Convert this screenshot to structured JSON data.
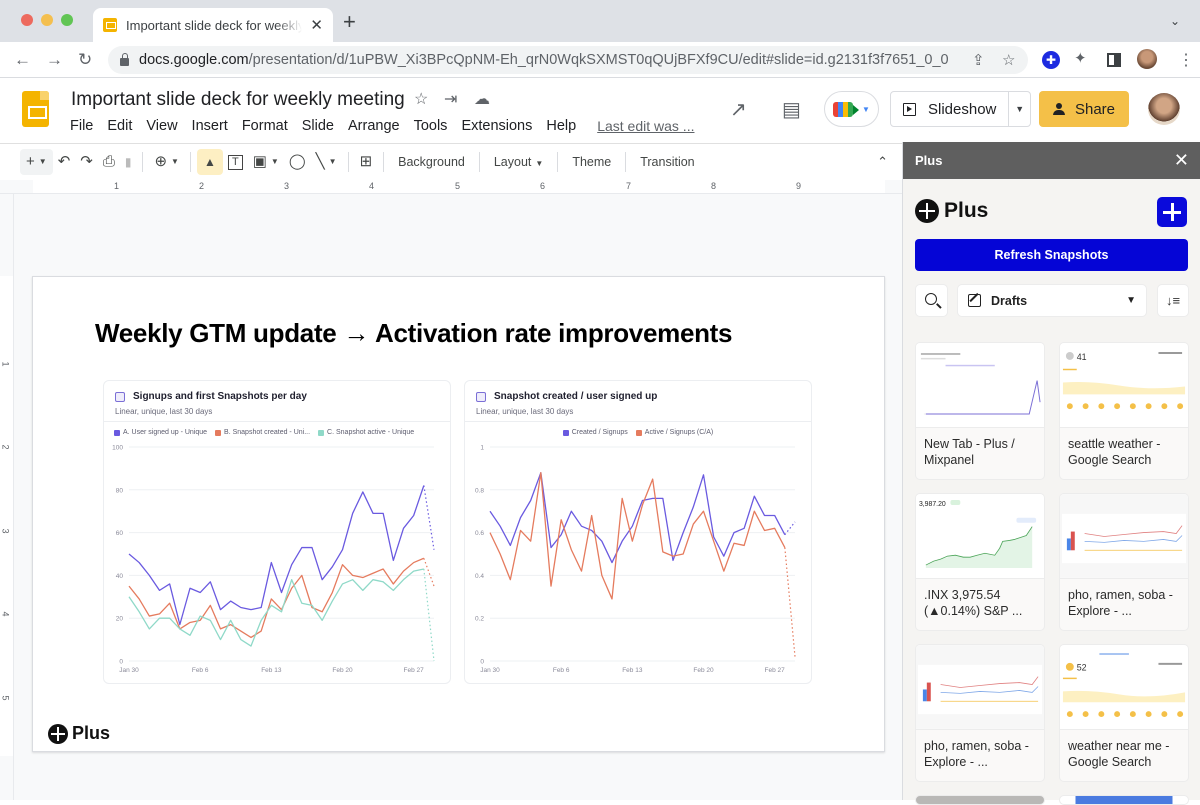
{
  "browser": {
    "tab_title": "Important slide deck for weekly meeting",
    "url_domain": "docs.google.com",
    "url_path": "/presentation/d/1uPBW_Xi3BPcQpNM-Eh_qrN0WqkSXMST0qQUjBFXf9CU/edit#slide=id.g2131f3f7651_0_0",
    "icons": {
      "back": "←",
      "forward": "→",
      "reload": "↻",
      "share": "⇪",
      "bookmark": "☆",
      "puzzle": "✦",
      "menu": "⋮",
      "new_tab": "+",
      "tab_close": "✕",
      "tab_list": "⌄"
    }
  },
  "app": {
    "doc_title": "Important slide deck for weekly meeting",
    "title_icons": {
      "star": "☆",
      "move": "⇥",
      "cloud": "☁"
    },
    "menu": [
      "File",
      "Edit",
      "View",
      "Insert",
      "Format",
      "Slide",
      "Arrange",
      "Tools",
      "Extensions",
      "Help"
    ],
    "last_edit": "Last edit was ...",
    "header_icons": {
      "activity": "↗",
      "comments": "▤"
    },
    "slideshow_label": "Slideshow",
    "share_label": "Share"
  },
  "toolbar": {
    "icons": {
      "add": "+",
      "undo": "↶",
      "redo": "↷",
      "print": "⎙",
      "paint_format": "🖌",
      "zoom": "⊕",
      "select": "➤",
      "textbox": "T",
      "image": "▣",
      "shape": "◯",
      "line": "╲",
      "comment": "⊞",
      "collapse": "⌃"
    },
    "background_label": "Background",
    "layout_label": "Layout",
    "theme_label": "Theme",
    "transition_label": "Transition"
  },
  "rulers": {
    "horizontal": [
      "1",
      "2",
      "3",
      "4",
      "5",
      "6",
      "7",
      "8",
      "9"
    ],
    "vertical": [
      "1",
      "2",
      "3",
      "4",
      "5"
    ]
  },
  "slide": {
    "title": "Weekly GTM update → Activation rate improvements",
    "logo_text": "Plus"
  },
  "chart_data": [
    {
      "type": "line",
      "title": "Signups and first Snapshots per day",
      "subtitle": "Linear, unique, last 30 days",
      "x": [
        "Jan 30",
        "Jan 31",
        "Feb 1",
        "Feb 2",
        "Feb 3",
        "Feb 4",
        "Feb 5",
        "Feb 6",
        "Feb 7",
        "Feb 8",
        "Feb 9",
        "Feb 10",
        "Feb 11",
        "Feb 12",
        "Feb 13",
        "Feb 14",
        "Feb 15",
        "Feb 16",
        "Feb 17",
        "Feb 18",
        "Feb 19",
        "Feb 20",
        "Feb 21",
        "Feb 22",
        "Feb 23",
        "Feb 24",
        "Feb 25",
        "Feb 26",
        "Feb 27",
        "Feb 28",
        "Mar 1"
      ],
      "xticks": [
        "Jan 30",
        "Feb 6",
        "Feb 13",
        "Feb 20",
        "Feb 27"
      ],
      "yticks": [
        0,
        20,
        40,
        60,
        80,
        100
      ],
      "ylim": [
        0,
        100
      ],
      "grid": true,
      "legend": "top",
      "partial_last_point": true,
      "series": [
        {
          "name": "A. User signed up - Unique",
          "color": "#6a5ae0",
          "values": [
            50,
            46,
            40,
            33,
            36,
            17,
            34,
            32,
            37,
            24,
            28,
            25,
            24,
            25,
            46,
            32,
            45,
            53,
            53,
            38,
            44,
            52,
            69,
            79,
            69,
            69,
            47,
            62,
            68,
            82,
            52
          ]
        },
        {
          "name": "B. Snapshot created - Uni...",
          "color": "#e57b5e",
          "values": [
            35,
            29,
            21,
            22,
            27,
            15,
            18,
            19,
            26,
            15,
            17,
            14,
            11,
            14,
            29,
            24,
            34,
            40,
            25,
            23,
            32,
            45,
            40,
            39,
            41,
            43,
            36,
            42,
            46,
            48,
            35
          ]
        },
        {
          "name": "C. Snapshot active - Unique",
          "color": "#8fd9c8",
          "values": [
            30,
            23,
            15,
            20,
            20,
            15,
            12,
            21,
            19,
            10,
            19,
            10,
            7,
            19,
            26,
            23,
            38,
            27,
            26,
            19,
            28,
            36,
            38,
            33,
            38,
            37,
            33,
            38,
            42,
            43,
            0
          ]
        }
      ]
    },
    {
      "type": "line",
      "title": "Snapshot created / user signed up",
      "subtitle": "Linear, unique, last 30 days",
      "x": [
        "Jan 30",
        "Jan 31",
        "Feb 1",
        "Feb 2",
        "Feb 3",
        "Feb 4",
        "Feb 5",
        "Feb 6",
        "Feb 7",
        "Feb 8",
        "Feb 9",
        "Feb 10",
        "Feb 11",
        "Feb 12",
        "Feb 13",
        "Feb 14",
        "Feb 15",
        "Feb 16",
        "Feb 17",
        "Feb 18",
        "Feb 19",
        "Feb 20",
        "Feb 21",
        "Feb 22",
        "Feb 23",
        "Feb 24",
        "Feb 25",
        "Feb 26",
        "Feb 27",
        "Feb 28",
        "Mar 1"
      ],
      "xticks": [
        "Jan 30",
        "Feb 6",
        "Feb 13",
        "Feb 20",
        "Feb 27"
      ],
      "yticks": [
        0,
        0.2,
        0.4,
        0.6,
        0.8,
        1
      ],
      "ylim": [
        0,
        1
      ],
      "grid": true,
      "legend": "top-center",
      "partial_last_point": true,
      "series": [
        {
          "name": "Created / Signups",
          "color": "#6a5ae0",
          "values": [
            0.7,
            0.63,
            0.54,
            0.67,
            0.75,
            0.88,
            0.53,
            0.59,
            0.7,
            0.63,
            0.61,
            0.56,
            0.46,
            0.56,
            0.63,
            0.75,
            0.76,
            0.76,
            0.47,
            0.6,
            0.72,
            0.87,
            0.58,
            0.49,
            0.6,
            0.62,
            0.77,
            0.68,
            0.68,
            0.59,
            0.65
          ]
        },
        {
          "name": "Active / Signups (C/A)",
          "color": "#e57b5e",
          "values": [
            0.6,
            0.5,
            0.38,
            0.61,
            0.56,
            0.88,
            0.35,
            0.66,
            0.52,
            0.42,
            0.68,
            0.4,
            0.29,
            0.76,
            0.56,
            0.73,
            0.85,
            0.51,
            0.49,
            0.5,
            0.64,
            0.7,
            0.56,
            0.42,
            0.55,
            0.54,
            0.7,
            0.61,
            0.62,
            0.53,
            0.02
          ]
        }
      ]
    }
  ],
  "panel": {
    "header_title": "Plus",
    "close_icon": "✕",
    "brand": "Plus",
    "refresh_label": "Refresh Snapshots",
    "filter_value": "Drafts",
    "sort_icon": "↓≡",
    "chevron": "⌄",
    "cards": [
      {
        "label": "New Tab - Plus / Mixpanel",
        "thumb": "line-chart"
      },
      {
        "label": "seattle weather - Google Search",
        "thumb": "weather",
        "temp": "41"
      },
      {
        "label": ".INX 3,975.54 (▲0.14%) S&P ...",
        "thumb": "stock",
        "price": "3,987.20"
      },
      {
        "label": "pho, ramen, soba - Explore - ...",
        "thumb": "trends"
      },
      {
        "label": "pho, ramen, soba - Explore - ...",
        "thumb": "trends"
      },
      {
        "label": "weather near me - Google Search",
        "thumb": "weather",
        "temp": "52"
      }
    ]
  }
}
